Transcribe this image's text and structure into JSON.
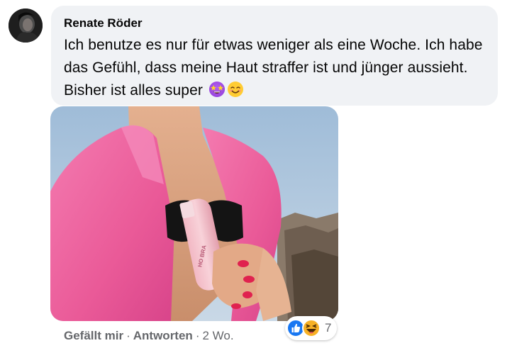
{
  "comment": {
    "author": "Renate Röder",
    "text": "Ich benutze es nur für etwas weniger als eine Woche. Ich habe das Gefühl, dass meine Haut straffer ist und jünger aussieht. Bisher ist alles super",
    "emojis": [
      "star-struck-emoji",
      "smiling-face-emoji"
    ],
    "image_product_text": [
      "HO BRA"
    ]
  },
  "actions": {
    "like": "Gefällt mir",
    "reply": "Antworten",
    "separator": "·",
    "time": "2 Wo."
  },
  "reactions": {
    "icons": [
      "like-reaction-icon",
      "haha-reaction-icon"
    ],
    "count": "7",
    "like_color": "#1877f2",
    "haha_color": "#f7b125"
  },
  "colors": {
    "bubble": "#f0f2f5",
    "text": "#050505",
    "secondary": "#65676b",
    "shirt": "#f06aa0"
  }
}
